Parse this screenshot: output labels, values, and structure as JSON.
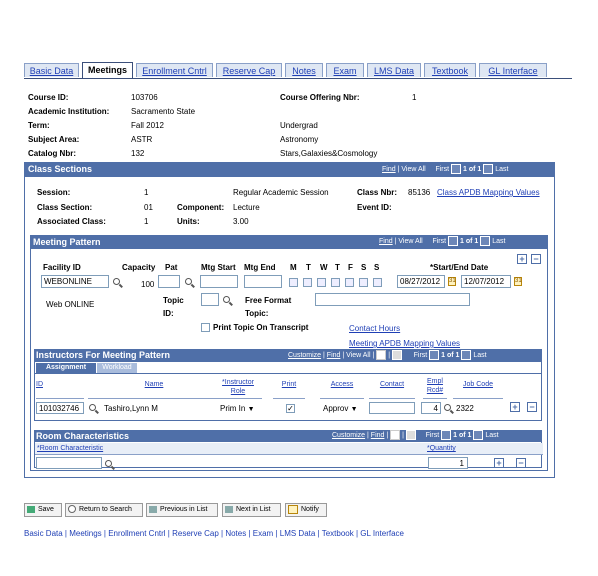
{
  "tabs": [
    "Basic Data",
    "Meetings",
    "Enrollment Cntrl",
    "Reserve Cap",
    "Notes",
    "Exam",
    "LMS Data",
    "Textbook",
    "GL Interface"
  ],
  "active_tab": "Meetings",
  "course": {
    "course_id_label": "Course ID:",
    "course_id": "103706",
    "offering_label": "Course Offering Nbr:",
    "offering": "1",
    "institution_label": "Academic Institution:",
    "institution": "Sacramento State",
    "term_label": "Term:",
    "term": "Fall 2012",
    "career": "Undergrad",
    "subject_label": "Subject Area:",
    "subject": "ASTR",
    "subject_desc": "Astronomy",
    "catalog_label": "Catalog Nbr:",
    "catalog": "132",
    "catalog_desc": "Stars,Galaxies&Cosmology"
  },
  "class_sections": {
    "title": "Class Sections",
    "nav": {
      "find": "Find",
      "viewall": "View All",
      "first": "First",
      "count": "1 of 1",
      "last": "Last"
    },
    "session_label": "Session:",
    "session": "1",
    "session_desc": "Regular Academic Session",
    "class_nbr_label": "Class Nbr:",
    "class_nbr": "85136",
    "apdb_link": "Class APDB Mapping Values",
    "section_label": "Class Section:",
    "section": "01",
    "component_label": "Component:",
    "component": "Lecture",
    "event_label": "Event ID:",
    "assoc_label": "Associated Class:",
    "assoc": "1",
    "units_label": "Units:",
    "units": "3.00"
  },
  "meeting_pattern": {
    "title": "Meeting Pattern",
    "nav": {
      "find": "Find",
      "viewall": "View All",
      "first": "First",
      "count": "1 of 1",
      "last": "Last"
    },
    "facility_label": "Facility ID",
    "facility": "WEBONLINE",
    "facility_desc": "Web  ONLINE",
    "capacity_label": "Capacity",
    "capacity": "100",
    "pat_label": "Pat",
    "mtg_start_label": "Mtg Start",
    "mtg_end_label": "Mtg End",
    "days": [
      "M",
      "T",
      "W",
      "T",
      "F",
      "S",
      "S"
    ],
    "dates_label": "*Start/End Date",
    "start_date": "08/27/2012",
    "end_date": "12/07/2012",
    "topic_label1": "Topic",
    "topic_label2": "ID:",
    "free_format_label1": "Free Format",
    "free_format_label2": "Topic:",
    "print_topic_label": "Print Topic On Transcript",
    "contact_hours_link": "Contact Hours",
    "meeting_apdb_link": "Meeting APDB Mapping Values"
  },
  "instructors": {
    "title": "Instructors For Meeting Pattern",
    "nav": {
      "customize": "Customize",
      "find": "Find",
      "viewall": "View All",
      "first": "First",
      "count": "1 of 1",
      "last": "Last"
    },
    "subtabs": [
      "Assignment",
      "Workload"
    ],
    "columns": [
      "ID",
      "Name",
      "*Instructor Role",
      "Print",
      "Access",
      "Contact",
      "Empl Rcd#",
      "Job Code"
    ],
    "row": {
      "id": "101032746",
      "name": "Tashiro,Lynn M",
      "role": "Prim In",
      "access": "Approv",
      "empl_rcd": "4",
      "job_code": "2322"
    }
  },
  "room": {
    "title": "Room Characteristics",
    "nav": {
      "customize": "Customize",
      "find": "Find",
      "first": "First",
      "count": "1 of 1",
      "last": "Last"
    },
    "col1": "*Room Characteristic",
    "col2": "*Quantity",
    "quantity": "1"
  },
  "buttons": {
    "save": "Save",
    "return": "Return to Search",
    "prev": "Previous in List",
    "next": "Next in List",
    "notify": "Notify"
  },
  "footer_links": [
    "Basic Data",
    "Meetings",
    "Enrollment Cntrl",
    "Reserve Cap",
    "Notes",
    "Exam",
    "LMS Data",
    "Textbook",
    "GL Interface"
  ],
  "colors": {
    "header_blue": "#4f6fa8",
    "link_blue": "#1f3fb5"
  }
}
